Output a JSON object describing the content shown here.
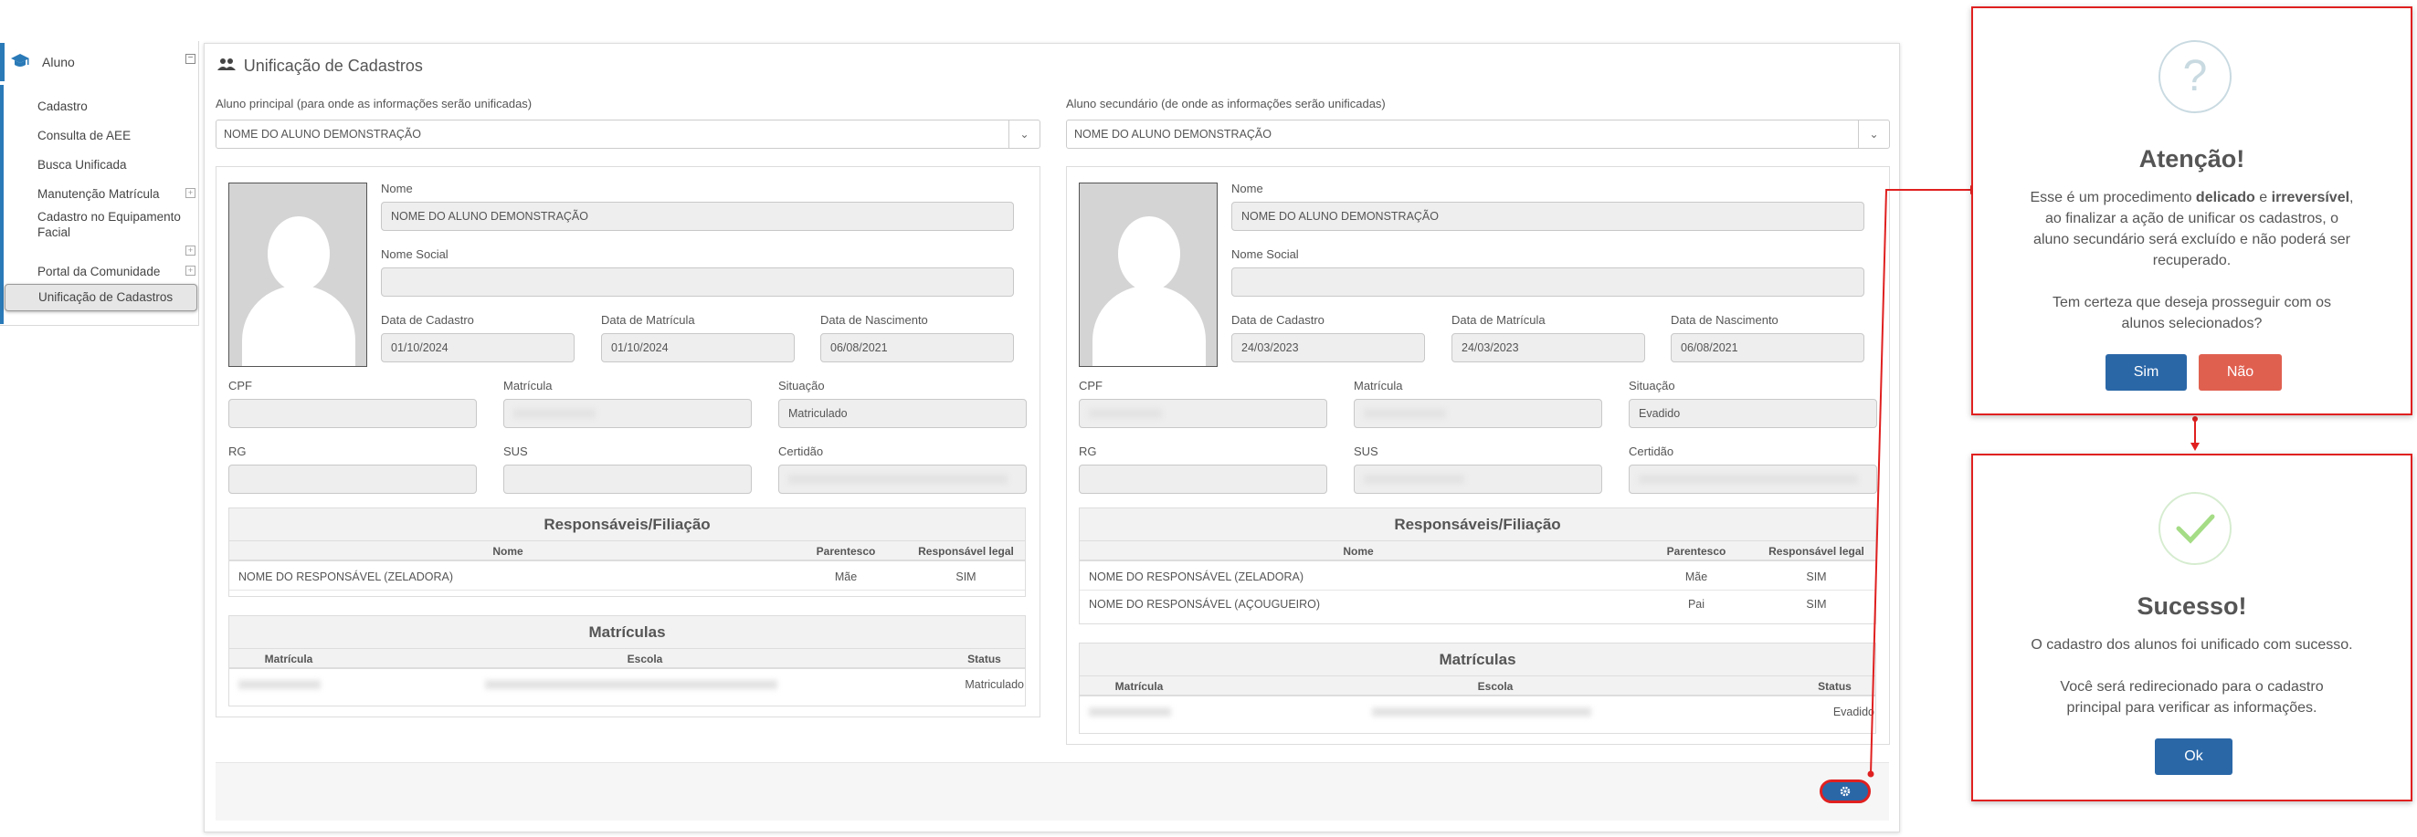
{
  "sidebar": {
    "section": "Aluno",
    "items": [
      "Cadastro",
      "Consulta de AEE",
      "Busca Unificada",
      "Manutenção Matrícula",
      "Cadastro no Equipamento Facial",
      "Portal da Comunidade",
      "Unificação de Cadastros"
    ]
  },
  "page": {
    "title": "Unificação de Cadastros",
    "principal_label": "Aluno principal (para onde as informações serão unificadas)",
    "secundario_label": "Aluno secundário (de onde as informações serão unificadas)"
  },
  "labels": {
    "nome": "Nome",
    "nome_social": "Nome Social",
    "data_cadastro": "Data de Cadastro",
    "data_matricula": "Data de Matrícula",
    "data_nascimento": "Data de Nascimento",
    "cpf": "CPF",
    "matricula": "Matrícula",
    "situacao": "Situação",
    "rg": "RG",
    "sus": "SUS",
    "certidao": "Certidão",
    "responsaveis": "Responsáveis/Filiação",
    "col_nome": "Nome",
    "col_parentesco": "Parentesco",
    "col_resp_legal": "Responsável legal",
    "matriculas": "Matrículas",
    "col_matricula": "Matrícula",
    "col_escola": "Escola",
    "col_status": "Status"
  },
  "left": {
    "select": "NOME DO ALUNO DEMONSTRAÇÃO",
    "nome": "NOME DO ALUNO DEMONSTRAÇÃO",
    "data_cadastro": "01/10/2024",
    "data_matricula": "01/10/2024",
    "data_nascimento": "06/08/2021",
    "situacao": "Matriculado",
    "responsaveis": [
      {
        "nome": "NOME DO RESPONSÁVEL (ZELADORA)",
        "parentesco": "Mãe",
        "legal": "SIM"
      }
    ],
    "matriculas": [
      {
        "status": "Matriculado"
      }
    ]
  },
  "right": {
    "select": "NOME DO ALUNO DEMONSTRAÇÃO",
    "nome": "NOME DO ALUNO DEMONSTRAÇÃO",
    "data_cadastro": "24/03/2023",
    "data_matricula": "24/03/2023",
    "data_nascimento": "06/08/2021",
    "situacao": "Evadido",
    "responsaveis": [
      {
        "nome": "NOME DO RESPONSÁVEL (ZELADORA)",
        "parentesco": "Mãe",
        "legal": "SIM"
      },
      {
        "nome": "NOME DO RESPONSÁVEL (AÇOUGUEIRO)",
        "parentesco": "Pai",
        "legal": "SIM"
      }
    ],
    "matriculas": [
      {
        "status": "Evadido"
      }
    ]
  },
  "modal_confirm": {
    "icon": "question-icon",
    "title": "Atenção!",
    "t1": "Esse é um procedimento ",
    "b1": "delicado",
    "t2": " e ",
    "b2": "irreversível",
    "t3": ",",
    "line2": "ao finalizar a ação de unificar os cadastros, o",
    "line3": "aluno secundário será excluído e não poderá ser",
    "line4": "recuperado.",
    "line5": "Tem certeza que deseja prosseguir com os",
    "line6": "alunos selecionados?",
    "yes": "Sim",
    "no": "Não"
  },
  "modal_success": {
    "icon": "check-icon",
    "title": "Sucesso!",
    "line1": "O cadastro dos alunos foi unificado com sucesso.",
    "line2": "Você será redirecionado para o cadastro",
    "line3": "principal para verificar as informações.",
    "ok": "Ok"
  },
  "colors": {
    "primary": "#2a67a7",
    "danger": "#e06050",
    "highlight": "#e02020",
    "sidebar_accent": "#2a7ab8"
  }
}
